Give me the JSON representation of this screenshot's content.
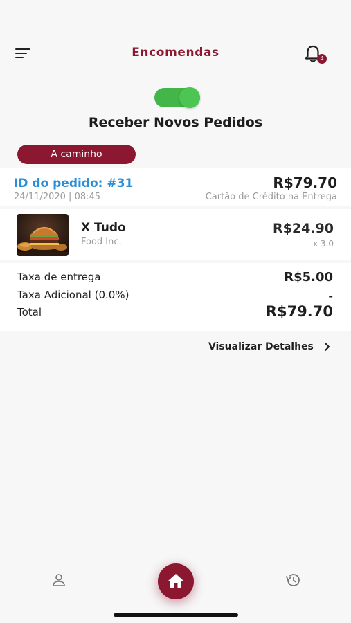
{
  "header": {
    "title": "Encomendas",
    "notification_count": "4"
  },
  "toggle": {
    "label": "Receber Novos Pedidos",
    "on": true
  },
  "order": {
    "status": "A caminho",
    "id_label": "ID do pedido: #31",
    "date": "24/11/2020 | 08:45",
    "total": "R$79.70",
    "payment_method": "Cartão de Crédito na Entrega",
    "item": {
      "name": "X Tudo",
      "vendor": "Food Inc.",
      "price": "R$24.90",
      "quantity": "x 3.0"
    },
    "summary": [
      {
        "label": "Taxa de entrega",
        "value": "R$5.00"
      },
      {
        "label": "Taxa Adicional (0.0%)",
        "value": "-"
      },
      {
        "label": "Total",
        "value": "R$79.70"
      }
    ]
  },
  "details_link": "Visualizar Detalhes",
  "bottom_nav": {
    "icons": [
      "user-icon",
      "home-icon",
      "history-icon"
    ]
  },
  "colors": {
    "brand": "#8c1730",
    "toggle": "#44b649",
    "link": "#2a8fd8"
  }
}
